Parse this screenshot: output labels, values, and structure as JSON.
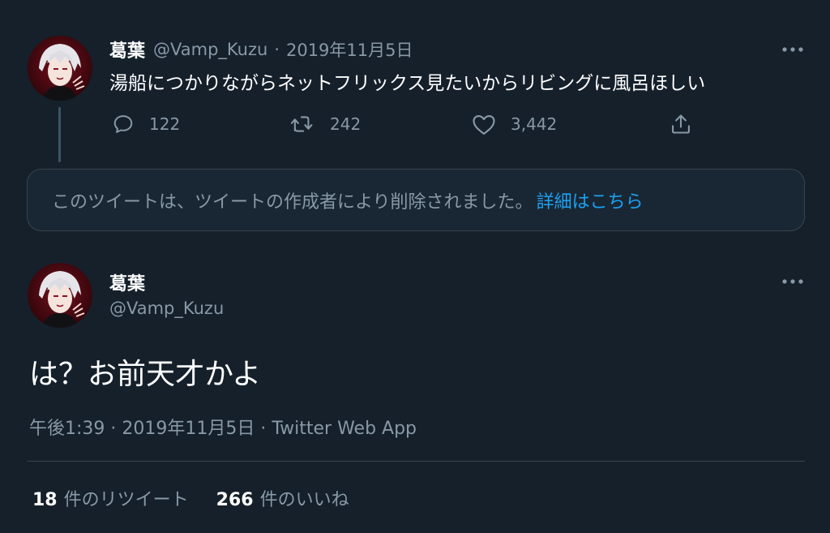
{
  "colors": {
    "background": "#15202b",
    "text_primary": "#ffffff",
    "text_secondary": "#8899a6",
    "link": "#1da1f2",
    "border": "#38444d"
  },
  "parent_tweet": {
    "display_name": "葛葉",
    "handle": "@Vamp_Kuzu",
    "separator": "·",
    "date": "2019年11月5日",
    "text": "湯船につかりながらネットフリックス見たいからリビングに風呂ほしい",
    "reply_count": "122",
    "retweet_count": "242",
    "like_count": "3,442",
    "icons": {
      "reply": "reply-icon",
      "retweet": "retweet-icon",
      "like": "heart-icon",
      "share": "share-icon",
      "more": "more-icon"
    }
  },
  "deleted_notice": {
    "text": "このツイートは、ツイートの作成者により削除されました。",
    "link_label": "詳細はこちら"
  },
  "main_tweet": {
    "display_name": "葛葉",
    "handle": "@Vamp_Kuzu",
    "text": "は？お前天才かよ",
    "meta": "午後1:39 · 2019年11月5日 · Twitter Web App"
  },
  "stats": {
    "retweets_num": "18",
    "retweets_label": "件のリツイート",
    "likes_num": "266",
    "likes_label": "件のいいね"
  }
}
